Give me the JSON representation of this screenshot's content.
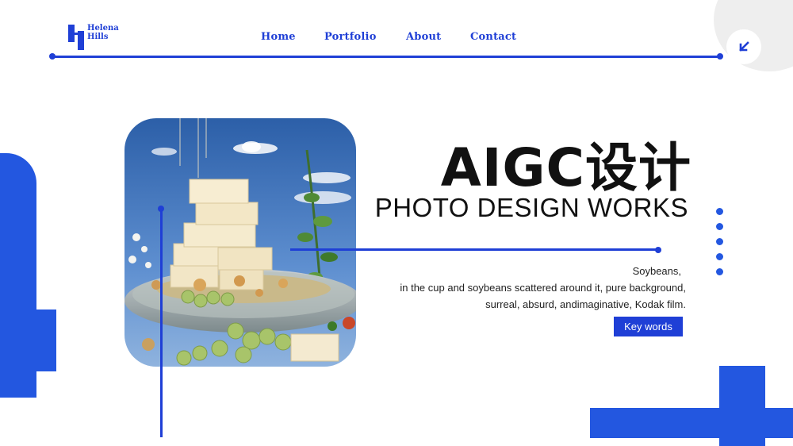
{
  "logo": {
    "line1": "Helena",
    "line2": "Hills"
  },
  "nav": {
    "home": "Home",
    "portfolio": "Portfolio",
    "about": "About",
    "contact": "Contact"
  },
  "corner_button": {
    "icon": "arrow-down-left-icon"
  },
  "hero": {
    "title": "AIGC设计",
    "subtitle": "PHOTO DESIGN WORKS",
    "desc_line1": "Soybeans,",
    "desc_line2": "in the cup and soybeans scattered around it, pure background,",
    "desc_line3": "surreal, absurd, andimaginative, Kodak film.",
    "keywords_button": "Key words"
  },
  "colors": {
    "accent": "#1f3fd6",
    "shape_blue": "#2357e0",
    "corner_gray": "#eeeeee"
  }
}
